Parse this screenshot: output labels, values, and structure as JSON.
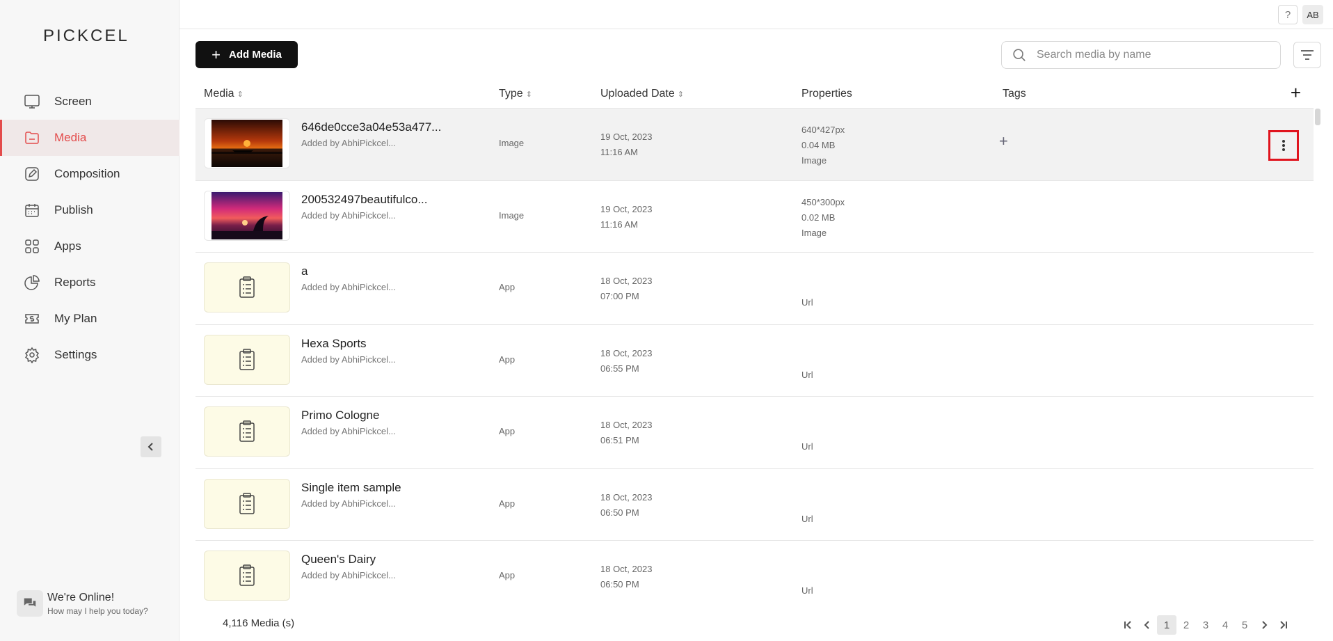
{
  "brand": {
    "logo_text": "PICKCEL"
  },
  "sidebar": {
    "items": [
      {
        "label": "Screen",
        "icon": "monitor-icon",
        "active": false
      },
      {
        "label": "Media",
        "icon": "folder-icon",
        "active": true
      },
      {
        "label": "Composition",
        "icon": "edit-icon",
        "active": false
      },
      {
        "label": "Publish",
        "icon": "calendar-icon",
        "active": false
      },
      {
        "label": "Apps",
        "icon": "apps-grid-icon",
        "active": false
      },
      {
        "label": "Reports",
        "icon": "pie-chart-icon",
        "active": false
      },
      {
        "label": "My Plan",
        "icon": "dollar-ticket-icon",
        "active": false
      },
      {
        "label": "Settings",
        "icon": "gear-icon",
        "active": false
      }
    ]
  },
  "chat": {
    "title": "We're Online!",
    "subtitle": "How may I help you today?"
  },
  "topbar": {
    "help_label": "?",
    "avatar_initials": "AB"
  },
  "toolbar": {
    "add_label": "Add Media",
    "search_placeholder": "Search media by name"
  },
  "table": {
    "columns": {
      "media": "Media",
      "type": "Type",
      "uploaded": "Uploaded Date",
      "properties": "Properties",
      "tags": "Tags"
    },
    "add_column_symbol": "+",
    "tag_add_symbol": "+",
    "rows": [
      {
        "name": "646de0cce3a04e53a477...",
        "by": "Added by AbhiPickcel...",
        "type": "Image",
        "date": "19 Oct, 2023",
        "time": "11:16 AM",
        "dims": "640*427px",
        "size": "0.04 MB",
        "ptype": "Image"
      },
      {
        "name": "200532497beautifulco...",
        "by": "Added by AbhiPickcel...",
        "type": "Image",
        "date": "19 Oct, 2023",
        "time": "11:16 AM",
        "dims": "450*300px",
        "size": "0.02 MB",
        "ptype": "Image"
      },
      {
        "name": "a",
        "by": "Added by AbhiPickcel...",
        "type": "App",
        "date": "18 Oct, 2023",
        "time": "07:00 PM",
        "url": "Url"
      },
      {
        "name": "Hexa Sports",
        "by": "Added by AbhiPickcel...",
        "type": "App",
        "date": "18 Oct, 2023",
        "time": "06:55 PM",
        "url": "Url"
      },
      {
        "name": "Primo Cologne",
        "by": "Added by AbhiPickcel...",
        "type": "App",
        "date": "18 Oct, 2023",
        "time": "06:51 PM",
        "url": "Url"
      },
      {
        "name": "Single item sample",
        "by": "Added by AbhiPickcel...",
        "type": "App",
        "date": "18 Oct, 2023",
        "time": "06:50 PM",
        "url": "Url"
      },
      {
        "name": "Queen's Dairy",
        "by": "Added by AbhiPickcel...",
        "type": "App",
        "date": "18 Oct, 2023",
        "time": "06:50 PM",
        "url": "Url"
      }
    ]
  },
  "footer": {
    "count": "4,116 Media (s)",
    "pages": [
      "1",
      "2",
      "3",
      "4",
      "5"
    ],
    "current_page": "1"
  }
}
